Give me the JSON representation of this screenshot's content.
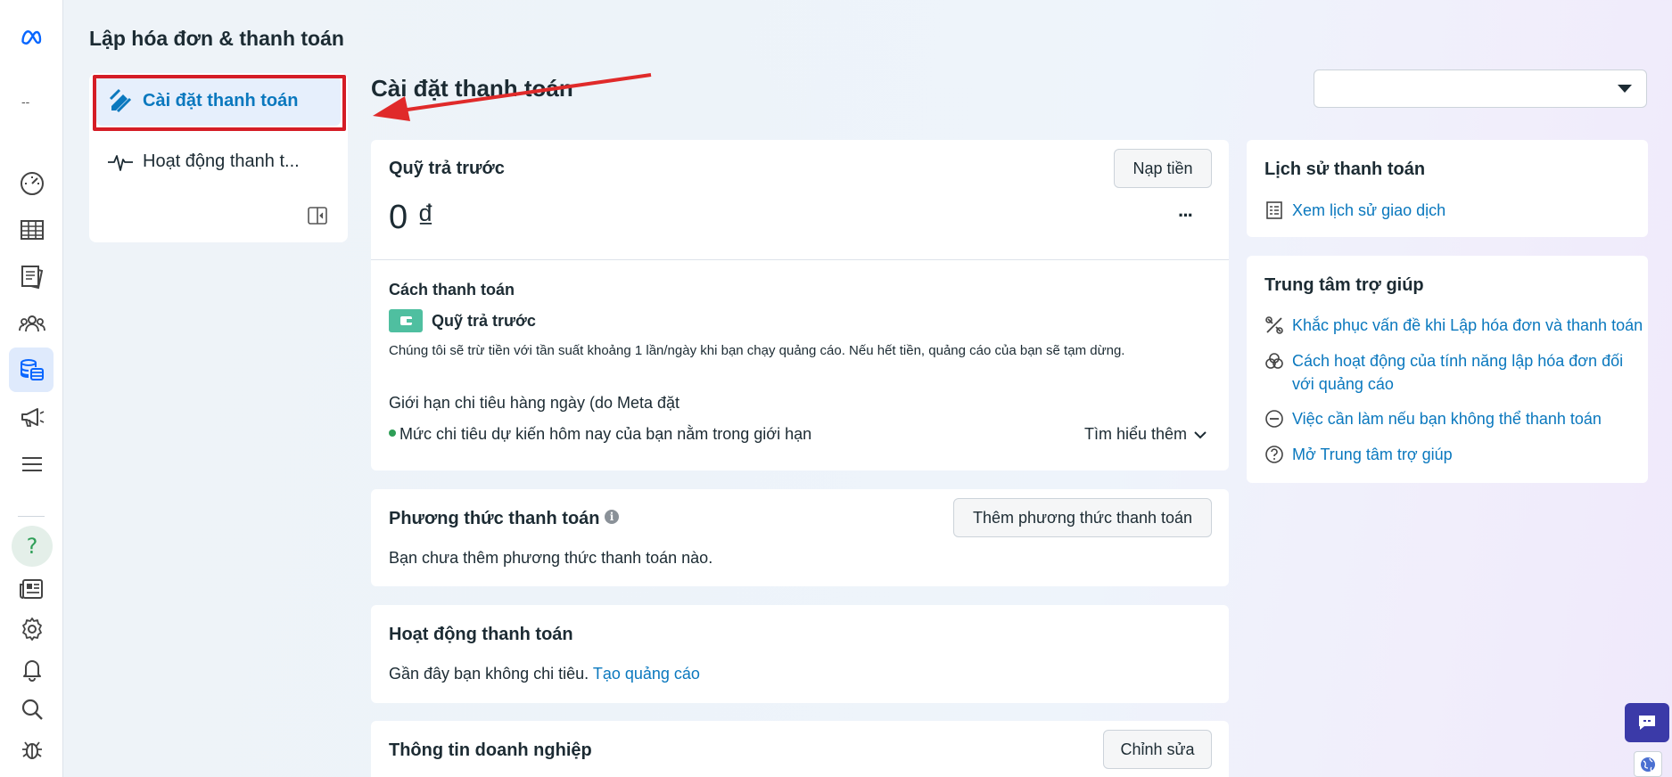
{
  "page_title": "Lập hóa đơn & thanh toán",
  "rail": {
    "dash": "--"
  },
  "subnav": {
    "items": [
      {
        "label": "Cài đặt thanh toán"
      },
      {
        "label": "Hoạt động thanh t..."
      }
    ]
  },
  "main": {
    "title": "Cài đặt thanh toán",
    "account_selector_value": ""
  },
  "prepaid": {
    "title": "Quỹ trả trước",
    "add_funds_label": "Nạp tiền",
    "balance": "0",
    "currency": "₫",
    "more": "···",
    "payment_method_heading": "Cách thanh toán",
    "payment_method_name": "Quỹ trả trước",
    "payment_method_desc": "Chúng tôi sẽ trừ tiền với tần suất khoảng 1 lần/ngày khi bạn chạy quảng cáo. Nếu hết tiền, quảng cáo của bạn sẽ tạm dừng.",
    "daily_limit_label": "Giới hạn chi tiêu hàng ngày (do Meta đặt",
    "daily_limit_status": "Mức chi tiêu dự kiến hôm nay của bạn nằm trong giới hạn",
    "learn_more": "Tìm hiểu thêm"
  },
  "payment_methods": {
    "title": "Phương thức thanh toán",
    "add_label": "Thêm phương thức thanh toán",
    "empty_text": "Bạn chưa thêm phương thức thanh toán nào."
  },
  "payment_activity": {
    "title": "Hoạt động thanh toán",
    "text": "Gần đây bạn không chi tiêu.",
    "link": "Tạo quảng cáo"
  },
  "business_info": {
    "title": "Thông tin doanh nghiệp",
    "edit_label": "Chỉnh sửa"
  },
  "history": {
    "title": "Lịch sử thanh toán",
    "link": "Xem lịch sử giao dịch"
  },
  "help": {
    "title": "Trung tâm trợ giúp",
    "links": [
      {
        "label": "Khắc phục vấn đề khi Lập hóa đơn và thanh toán"
      },
      {
        "label": "Cách hoạt động của tính năng lập hóa đơn đối với quảng cáo"
      },
      {
        "label": "Việc cần làm nếu bạn không thể thanh toán"
      },
      {
        "label": "Mở Trung tâm trợ giúp"
      }
    ]
  },
  "colors": {
    "accent": "#0a78be",
    "highlight_box": "#d51d26",
    "annotation_arrow": "#e02a2a",
    "wallet_green": "#4fbfa0",
    "status_green": "#2e9e57",
    "chat_button": "#3b3aa8"
  }
}
